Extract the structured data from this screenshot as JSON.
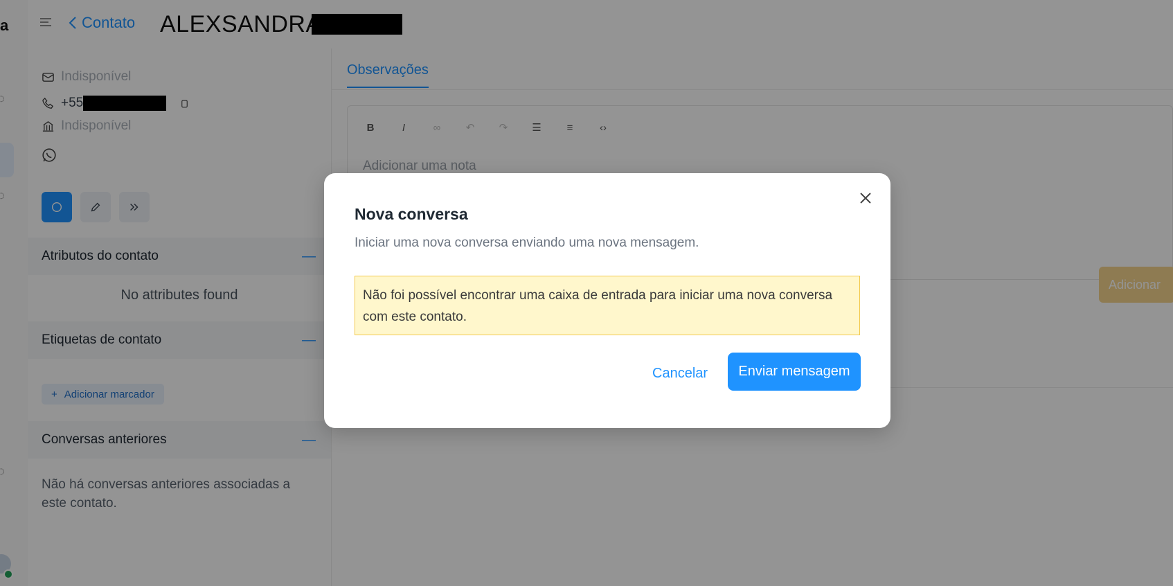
{
  "header": {
    "back_label": "Contato",
    "contact_name": "ALEXSANDRA"
  },
  "sidebar_rail": {
    "brand_fragment": "a"
  },
  "contact_info": {
    "email": "Indisponível",
    "phone_prefix": "+55",
    "company": "Indisponível",
    "channel_icon": "whatsapp-icon"
  },
  "sections": {
    "attributes": {
      "title": "Atributos do contato",
      "empty": "No attributes found"
    },
    "labels": {
      "title": "Etiquetas de contato",
      "add_label": "Adicionar marcador"
    },
    "previous": {
      "title": "Conversas anteriores",
      "empty": "Não há conversas anteriores associadas a este contato."
    }
  },
  "main": {
    "tab_label": "Observações",
    "editor_placeholder": "Adicionar uma nota",
    "add_button": "Adicionar",
    "toolbar": {
      "bold": "B",
      "italic": "I"
    }
  },
  "modal": {
    "title": "Nova conversa",
    "subtitle": "Iniciar uma nova conversa enviando uma nova mensagem.",
    "alert": "Não foi possível encontrar uma caixa de entrada para iniciar uma nova conversa com este contato.",
    "cancel": "Cancelar",
    "send": "Enviar mensagem"
  },
  "colors": {
    "accent": "#1f93ff",
    "alert_bg": "#fff7cc",
    "alert_border": "#f2c94c",
    "overlay": "rgba(0,0,0,0.42)"
  }
}
